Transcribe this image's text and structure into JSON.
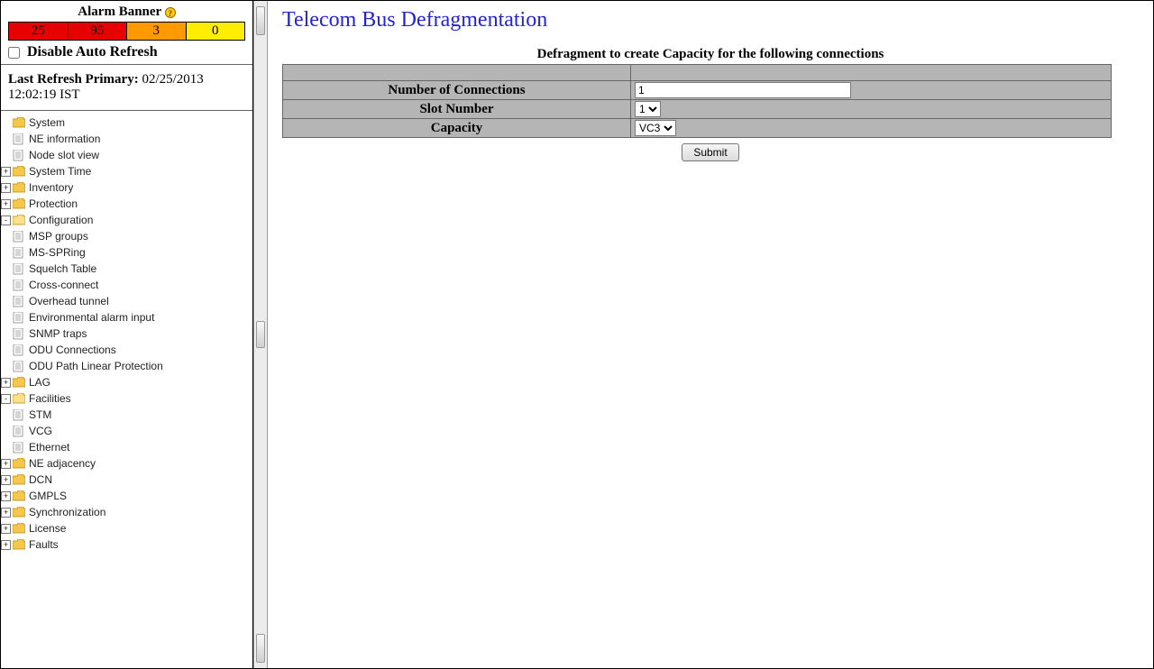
{
  "alarm": {
    "title": "Alarm Banner",
    "cells": [
      {
        "value": "25",
        "class": "ac-red"
      },
      {
        "value": "95",
        "class": "ac-red"
      },
      {
        "value": "3",
        "class": "ac-orange"
      },
      {
        "value": "0",
        "class": "ac-yellow"
      }
    ],
    "disable_label": "Disable Auto Refresh",
    "last_refresh_label": "Last Refresh Primary:",
    "last_refresh_value": "02/25/2013 12:02:19 IST"
  },
  "tree": [
    {
      "indent": 0,
      "kind": "folder",
      "expander": "",
      "label": "System"
    },
    {
      "indent": 1,
      "kind": "page",
      "expander": "",
      "label": "NE information"
    },
    {
      "indent": 1,
      "kind": "page",
      "expander": "",
      "label": "Node slot view"
    },
    {
      "indent": 1,
      "kind": "folder",
      "expander": "+",
      "label": "System Time"
    },
    {
      "indent": 1,
      "kind": "folder",
      "expander": "+",
      "label": "Inventory"
    },
    {
      "indent": 1,
      "kind": "folder",
      "expander": "+",
      "label": "Protection"
    },
    {
      "indent": 1,
      "kind": "folder-open",
      "expander": "-",
      "label": "Configuration"
    },
    {
      "indent": 2,
      "kind": "page",
      "expander": "",
      "label": "MSP groups"
    },
    {
      "indent": 2,
      "kind": "page",
      "expander": "",
      "label": "MS-SPRing"
    },
    {
      "indent": 2,
      "kind": "page",
      "expander": "",
      "label": "Squelch Table"
    },
    {
      "indent": 2,
      "kind": "page",
      "expander": "",
      "label": "Cross-connect"
    },
    {
      "indent": 2,
      "kind": "page",
      "expander": "",
      "label": "Overhead tunnel"
    },
    {
      "indent": 2,
      "kind": "page",
      "expander": "",
      "label": "Environmental alarm input"
    },
    {
      "indent": 2,
      "kind": "page",
      "expander": "",
      "label": "SNMP traps"
    },
    {
      "indent": 2,
      "kind": "page",
      "expander": "",
      "label": "ODU Connections"
    },
    {
      "indent": 2,
      "kind": "page",
      "expander": "",
      "label": "ODU Path Linear Protection"
    },
    {
      "indent": 2,
      "kind": "folder",
      "expander": "+",
      "label": "LAG"
    },
    {
      "indent": 2,
      "kind": "folder-open",
      "expander": "-",
      "label": "Facilities"
    },
    {
      "indent": 3,
      "kind": "page",
      "expander": "",
      "label": "STM"
    },
    {
      "indent": 3,
      "kind": "page",
      "expander": "",
      "label": "VCG"
    },
    {
      "indent": 3,
      "kind": "page",
      "expander": "",
      "label": "Ethernet"
    },
    {
      "indent": 2,
      "kind": "folder",
      "expander": "+",
      "label": "NE adjacency"
    },
    {
      "indent": 2,
      "kind": "folder",
      "expander": "+",
      "label": "DCN"
    },
    {
      "indent": 2,
      "kind": "folder",
      "expander": "+",
      "label": "GMPLS"
    },
    {
      "indent": 2,
      "kind": "folder",
      "expander": "+",
      "label": "Synchronization"
    },
    {
      "indent": 1,
      "kind": "folder",
      "expander": "+",
      "label": "License"
    },
    {
      "indent": 1,
      "kind": "folder",
      "expander": "+",
      "label": "Faults"
    }
  ],
  "main": {
    "title": "Telecom Bus Defragmentation",
    "caption": "Defragment to create Capacity for the following connections",
    "rows": {
      "num_conn_label": "Number of Connections",
      "num_conn_value": "1",
      "slot_label": "Slot Number",
      "slot_value": "1",
      "capacity_label": "Capacity",
      "capacity_value": "VC3"
    },
    "submit": "Submit"
  }
}
